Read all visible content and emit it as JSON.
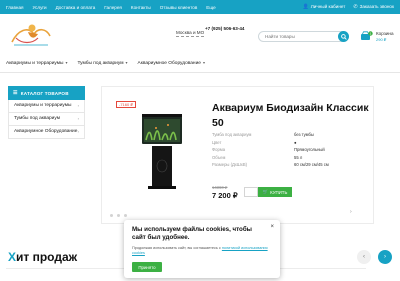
{
  "topbar": {
    "nav": [
      "Главная",
      "Услуги",
      "Доставка и оплата",
      "Галерея",
      "Контакты",
      "Отзывы клиентов",
      "Еще"
    ],
    "account": "Личный кабинет",
    "callback": "Заказать звонок"
  },
  "header": {
    "city": "Москва и МО",
    "phone": "+7 (925) 506-63-44",
    "search_placeholder": "Найти товары",
    "cart_label": "Корзина",
    "cart_sum": "290 ₽",
    "cart_count": "1"
  },
  "catnav": [
    "Аквариумы и террариумы",
    "Тумбы под аквариум",
    "Аквариумное Оборудование"
  ],
  "sidebar": {
    "header": "КАТАЛОГ ТОВАРОВ",
    "items": [
      "Аквариумы и террариумы",
      "Тумбы под аквариум",
      "Аквариумное Оборудование"
    ]
  },
  "product": {
    "badge": "-7160 ₽",
    "title": "Аквариум Биодизайн Классик 50",
    "specs": [
      {
        "k": "Тумба под аквариум",
        "v": "без тумбы"
      },
      {
        "k": "Цвет",
        "v": "●"
      },
      {
        "k": "Форма",
        "v": "Прямоугольный"
      },
      {
        "k": "Объем",
        "v": "55 л"
      },
      {
        "k": "Размеры (ДхШхВ)",
        "v": "60 см/29 см/45 см"
      }
    ],
    "old_price": "14360 ₽",
    "price": "7 200 ₽",
    "buy_label": "КУПИТЬ"
  },
  "hit": {
    "accent": "Х",
    "rest": "ит продаж"
  },
  "cookie": {
    "title": "Мы используем файлы cookies, чтобы сайт был удобнее.",
    "text": "Продолжая использовать сайт, вы соглашаетесь с",
    "link": "политикой использования cookies",
    "ok": "Принято",
    "close": "×"
  },
  "colors": {
    "accent": "#17a2c4",
    "buy": "#3cb043",
    "sale": "#e5483c"
  }
}
